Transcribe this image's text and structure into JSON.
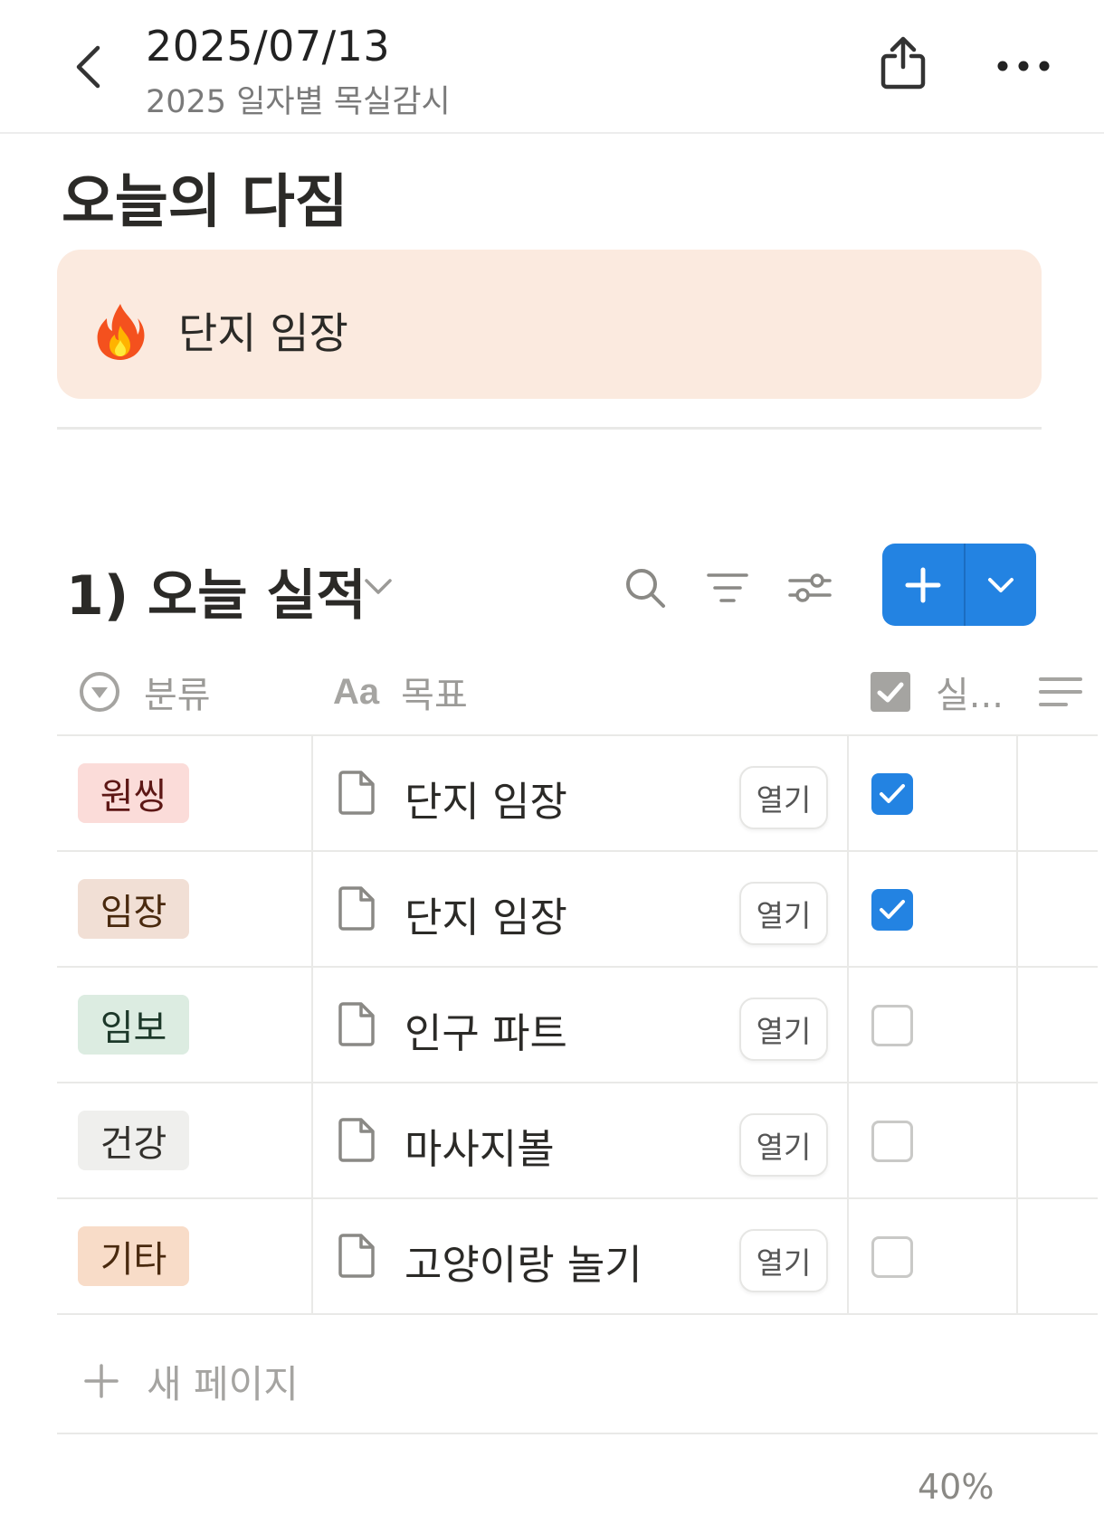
{
  "header": {
    "title": "2025/07/13",
    "subtitle": "2025 일자별 목실감시",
    "icons": {
      "back": "chevron-left-icon",
      "share": "share-icon",
      "more": "more-horizontal-icon"
    }
  },
  "page": {
    "heading": "오늘의 다짐",
    "callout": {
      "icon": "fire-emoji",
      "text": "단지 임장",
      "background": "#fbeadf"
    }
  },
  "database": {
    "title": "1) 오늘 실적",
    "accent": "#2383e2",
    "toolbar_icons": [
      "search-icon",
      "filter-icon",
      "settings-sliders-icon",
      "plus-icon",
      "chevron-down-icon"
    ],
    "columns": {
      "category": "분류",
      "goal": "목표",
      "done": "실..."
    },
    "open_label": "열기",
    "rows": [
      {
        "category": "원씽",
        "tag_bg": "#fbdcd9",
        "tag_fg": "#5d1715",
        "goal": "단지 임장",
        "done": true
      },
      {
        "category": "임장",
        "tag_bg": "#f1dfd5",
        "tag_fg": "#49290e",
        "goal": "단지 임장",
        "done": true
      },
      {
        "category": "임보",
        "tag_bg": "#dcece1",
        "tag_fg": "#1c3829",
        "goal": "인구 파트",
        "done": false
      },
      {
        "category": "건강",
        "tag_bg": "#efefed",
        "tag_fg": "#32302c",
        "goal": "마사지볼",
        "done": false
      },
      {
        "category": "기타",
        "tag_bg": "#f8dcc8",
        "tag_fg": "#49290e",
        "goal": "고양이랑 놀기",
        "done": false
      }
    ],
    "new_page_label": "새 페이지",
    "progress": "40%"
  }
}
